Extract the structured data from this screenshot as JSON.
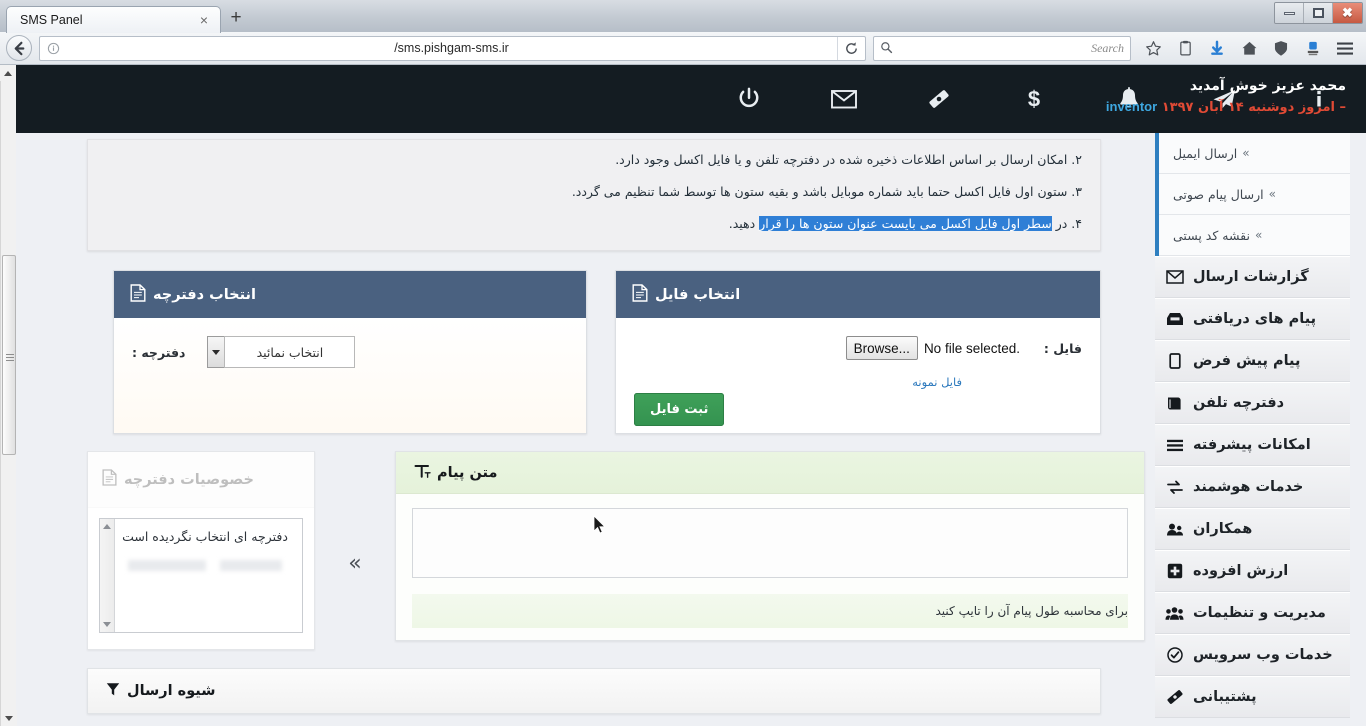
{
  "browser": {
    "tab_title": "SMS Panel",
    "tab_close": "×",
    "new_tab": "+",
    "url": "/sms.pishgam-sms.ir",
    "search_placeholder": "Search",
    "window_controls": {
      "minimize": "–",
      "restore": "❐",
      "close": "✕"
    }
  },
  "topbar": {
    "welcome_line1": "محمد عزیز خوش آمدید",
    "username": "inventor",
    "date_text": "– امروز دوشنبه ۱۴ آبان ۱۳۹۷",
    "nav": [
      {
        "icon": "power-icon",
        "name": "logout"
      },
      {
        "icon": "envelope-icon",
        "name": "messages"
      },
      {
        "icon": "ticket-icon",
        "name": "tickets"
      },
      {
        "icon": "dollar-icon",
        "name": "credit"
      },
      {
        "icon": "bell-icon",
        "name": "notifications"
      },
      {
        "icon": "paper-plane-icon",
        "name": "send"
      },
      {
        "icon": "info-icon",
        "name": "info"
      }
    ]
  },
  "sidebar": {
    "submenu": [
      {
        "label": "ارسال ایمیل",
        "chevron": "»"
      },
      {
        "label": "ارسال پیام صوتی",
        "chevron": "»"
      },
      {
        "label": "نقشه کد پستی",
        "chevron": "»"
      }
    ],
    "items": [
      {
        "label": "گزارشات ارسال",
        "icon": "envelope-icon"
      },
      {
        "label": "پیام های دریافتی",
        "icon": "inbox-icon"
      },
      {
        "label": "پیام پیش فرض",
        "icon": "mobile-icon"
      },
      {
        "label": "دفترچه تلفن",
        "icon": "book-icon"
      },
      {
        "label": "امکانات پیشرفته",
        "icon": "list-icon"
      },
      {
        "label": "خدمات هوشمند",
        "icon": "exchange-icon"
      },
      {
        "label": "همکاران",
        "icon": "users-icon"
      },
      {
        "label": "ارزش افزوده",
        "icon": "plus-square-icon"
      },
      {
        "label": "مدیریت و تنظیمات",
        "icon": "group-icon"
      },
      {
        "label": "خدمات وب سرویس",
        "icon": "check-circle-icon"
      },
      {
        "label": "پشتیبانی",
        "icon": "ticket-icon"
      }
    ]
  },
  "instructions": [
    "۲. امکان ارسال بر اساس اطلاعات ذخیره شده در دفترچه تلفن و یا فایل اکسل وجود دارد.",
    "۳. ستون اول فایل اکسل حتما باید شماره موبایل باشد و بقیه ستون ها توسط شما تنظیم می گردد."
  ],
  "instruction4": {
    "prefix": "۴. در ",
    "highlight": "سطر اول فایل اکسل می بایست عنوان ستون ها را قرار",
    "suffix": " دهید."
  },
  "ledger_card": {
    "title": "انتخاب دفترچه",
    "icon": "document-icon",
    "field_label": "دفترچه :",
    "select_value": "انتخاب نمائید"
  },
  "file_card": {
    "title": "انتخاب فایل",
    "icon": "document-icon",
    "field_label": "فایل :",
    "browse_label": "Browse...",
    "no_file_text": "No file selected.",
    "sample_link": "فایل نمونه",
    "submit_label": "ثبت فایل"
  },
  "props_card": {
    "title": "خصوصیات دفترچه",
    "icon": "document-icon",
    "empty_message": "دفترچه ای انتخاب نگردیده است"
  },
  "arrow_separator": "»",
  "message_card": {
    "title": "متن پیام",
    "icon": "text-format-icon",
    "textarea_value": "",
    "hint": "برای محاسبه طول پیام آن را تایپ کنید"
  },
  "sendmode_card": {
    "title": "شیوه ارسال",
    "icon": "filter-icon"
  },
  "colors": {
    "topbar_bg": "#141c22",
    "card_header_blue": "#4a6180",
    "accent_blue": "#2e7fc0",
    "green_button": "#3fa059",
    "highlight_blue": "#2f7fd6",
    "username_blue": "#3ea7e0",
    "date_red": "#e04a35",
    "page_bg": "#eef0f4"
  }
}
